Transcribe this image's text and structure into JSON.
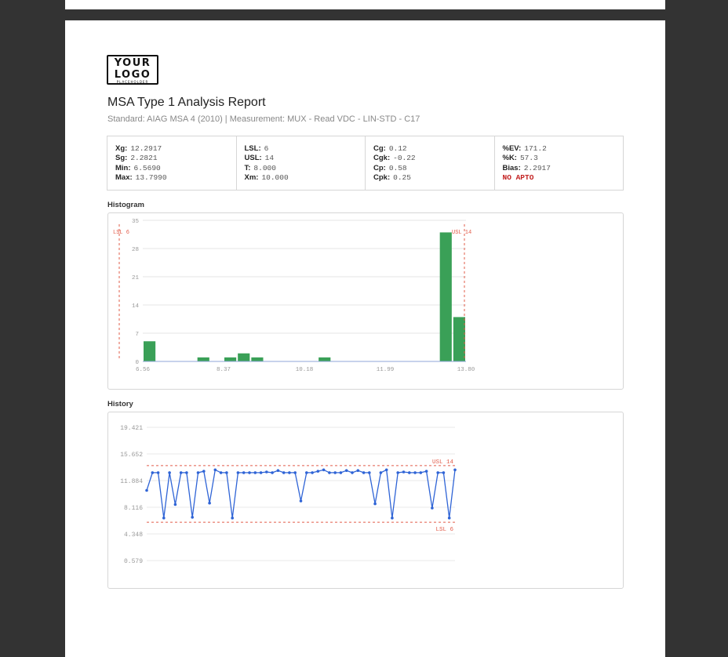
{
  "logo": {
    "line1": "YOUR",
    "line2": "LOGO",
    "line3": "PLACEHOLDER"
  },
  "report": {
    "title": "MSA Type 1 Analysis Report",
    "subtitle": "Standard: AIAG MSA 4 (2010) | Measurement: MUX - Read VDC - LIN-STD - C17"
  },
  "stats": {
    "col1": [
      {
        "label": "Xg:",
        "value": "12.2917"
      },
      {
        "label": "Sg:",
        "value": "2.2821"
      },
      {
        "label": "Min:",
        "value": "6.5690"
      },
      {
        "label": "Max:",
        "value": "13.7990"
      }
    ],
    "col2": [
      {
        "label": "LSL:",
        "value": "6"
      },
      {
        "label": "USL:",
        "value": "14"
      },
      {
        "label": "T:",
        "value": "8.000"
      },
      {
        "label": "Xm:",
        "value": "10.000"
      }
    ],
    "col3": [
      {
        "label": "Cg:",
        "value": "0.12"
      },
      {
        "label": "Cgk:",
        "value": "-0.22"
      },
      {
        "label": "Cp:",
        "value": "0.58"
      },
      {
        "label": "Cpk:",
        "value": "0.25"
      }
    ],
    "col4": [
      {
        "label": "%EV:",
        "value": "171.2"
      },
      {
        "label": "%K:",
        "value": "57.3"
      },
      {
        "label": "Bias:",
        "value": "2.2917"
      }
    ],
    "verdict": "NO APTO",
    "verdict_color": "#c21f1f"
  },
  "sections": {
    "histogram": "Histogram",
    "history": "History"
  },
  "chart_data": [
    {
      "type": "bar",
      "title": "Histogram",
      "ylim": [
        0,
        35
      ],
      "yticks": [
        "0",
        "7",
        "14",
        "21",
        "28",
        "35"
      ],
      "xticks": [
        "6.56",
        "8.37",
        "10.18",
        "11.99",
        "13.80"
      ],
      "bin_start": 6.569,
      "bin_width": 0.3614,
      "values": [
        5,
        0,
        0,
        0,
        1,
        0,
        1,
        2,
        1,
        0,
        0,
        0,
        0,
        1,
        0,
        0,
        0,
        0,
        0,
        0,
        0,
        0,
        32,
        11
      ],
      "lsl_label": "LSL 6",
      "usl_label": "USL 14",
      "bar_color": "#3aa057",
      "limit_color": "#e25c4a"
    },
    {
      "type": "line",
      "title": "History",
      "ylim": [
        0.579,
        19.421
      ],
      "yticks": [
        "19.421",
        "15.652",
        "11.884",
        "8.116",
        "4.348",
        "0.579"
      ],
      "values": [
        10.5,
        13.0,
        13.0,
        6.6,
        13.0,
        8.5,
        13.0,
        13.0,
        6.7,
        13.0,
        13.2,
        8.7,
        13.4,
        13.0,
        13.0,
        6.6,
        13.0,
        13.0,
        13.0,
        13.0,
        13.0,
        13.1,
        13.0,
        13.3,
        13.0,
        13.0,
        13.0,
        9.0,
        13.0,
        13.0,
        13.2,
        13.4,
        13.0,
        13.0,
        13.0,
        13.3,
        13.0,
        13.3,
        13.0,
        13.0,
        8.6,
        13.0,
        13.4,
        6.6,
        13.0,
        13.1,
        13.0,
        13.0,
        13.0,
        13.2,
        8.0,
        13.0,
        13.0,
        6.6,
        13.4
      ],
      "usl": 14,
      "lsl": 6,
      "usl_label": "USL 14",
      "lsl_label": "LSL 6",
      "line_color": "#2f64d6",
      "limit_color": "#e25c4a"
    }
  ]
}
